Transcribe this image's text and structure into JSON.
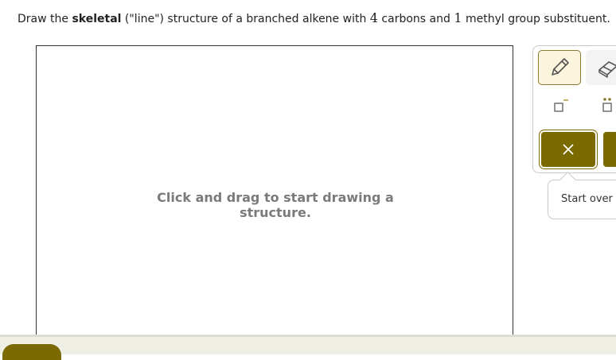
{
  "prompt": {
    "part1": "Draw the ",
    "bold": "skeletal",
    "part2": " (\"line\") structure of a branched alkene with ",
    "num1": "4",
    "part3": " carbons and ",
    "num2": "1",
    "part4": " methyl group substituent."
  },
  "canvas": {
    "hint": "Click and drag to start drawing a structure."
  },
  "toolbox": {
    "tools": [
      {
        "icon": "pencil-icon",
        "active": true
      },
      {
        "icon": "eraser-icon",
        "active": false
      },
      {
        "icon": "negative-charge-icon",
        "active": false
      },
      {
        "icon": "lone-pair-icon",
        "active": false
      },
      {
        "icon": "close-icon",
        "active": false
      }
    ]
  },
  "tooltip": {
    "label": "Start over"
  },
  "colors": {
    "accent": "#7a6a00",
    "accent_light": "#fbf5de",
    "hint_text": "#7a7a7a"
  }
}
